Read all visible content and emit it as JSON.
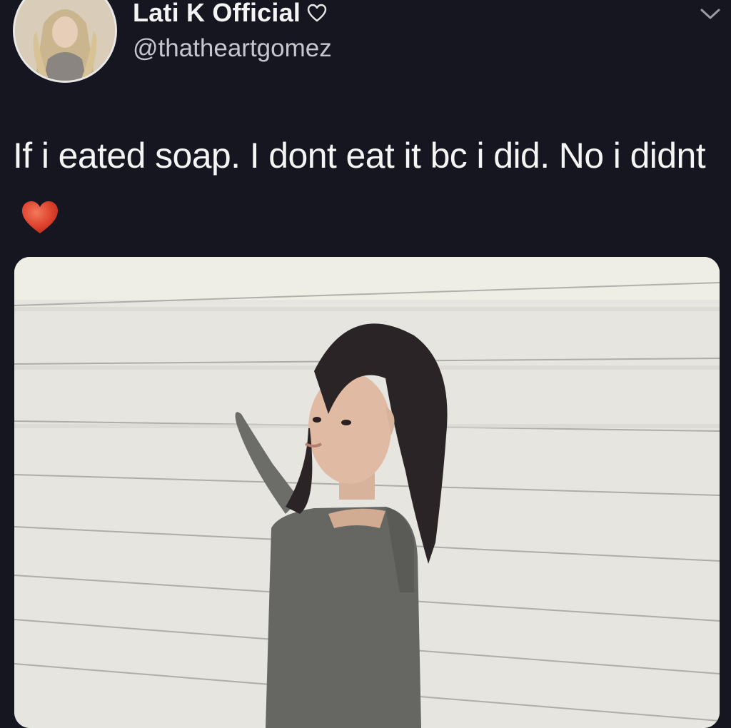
{
  "tweet": {
    "author": {
      "display_name": "Lati K Official",
      "handle": "@thatheartgomez",
      "badge_icon": "heart-outline-icon"
    },
    "menu_icon": "chevron-down-icon",
    "text": "If i eated soap. I dont eat it bc i did. No i didnt",
    "emoji": "heart-emoji-icon",
    "media": {
      "type": "photo"
    }
  },
  "colors": {
    "background": "#15161f",
    "text": "#f5f5f5",
    "secondary_text": "#c6c6cc",
    "heart_emoji": "#e0432f"
  }
}
